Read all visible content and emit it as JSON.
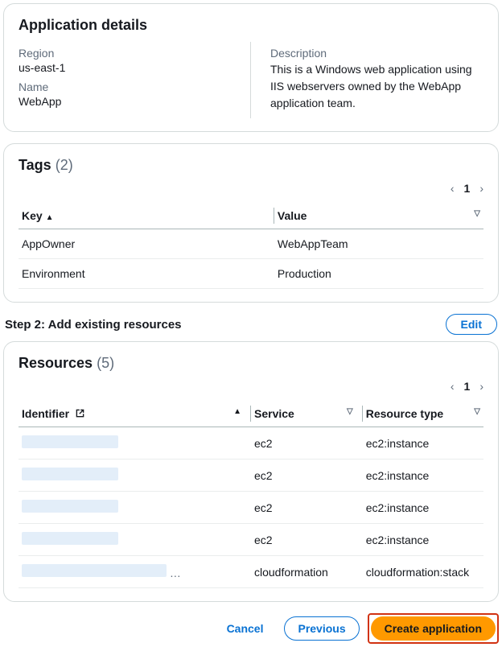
{
  "app_details": {
    "title": "Application details",
    "region_label": "Region",
    "region_value": "us-east-1",
    "name_label": "Name",
    "name_value": "WebApp",
    "description_label": "Description",
    "description_value": "This is a Windows web application using IIS webservers owned by the WebApp application team."
  },
  "tags": {
    "title": "Tags",
    "count": "(2)",
    "page": "1",
    "columns": {
      "key": "Key",
      "value": "Value"
    },
    "rows": [
      {
        "key": "AppOwner",
        "value": "WebAppTeam"
      },
      {
        "key": "Environment",
        "value": "Production"
      }
    ]
  },
  "step2": {
    "title": "Step 2: Add existing resources",
    "edit": "Edit"
  },
  "resources": {
    "title": "Resources",
    "count": "(5)",
    "page": "1",
    "columns": {
      "identifier": "Identifier",
      "service": "Service",
      "type": "Resource type"
    },
    "rows": [
      {
        "service": "ec2",
        "type": "ec2:instance"
      },
      {
        "service": "ec2",
        "type": "ec2:instance"
      },
      {
        "service": "ec2",
        "type": "ec2:instance"
      },
      {
        "service": "ec2",
        "type": "ec2:instance"
      },
      {
        "service": "cloudformation",
        "type": "cloudformation:stack"
      }
    ]
  },
  "actions": {
    "cancel": "Cancel",
    "previous": "Previous",
    "create": "Create application"
  }
}
